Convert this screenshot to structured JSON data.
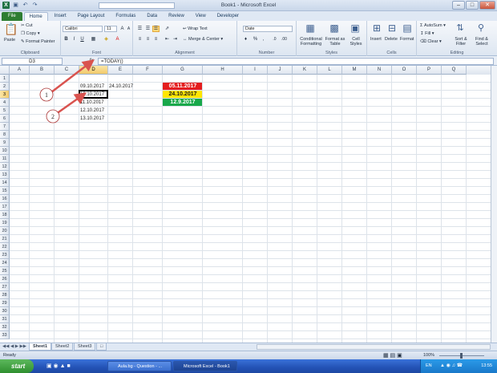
{
  "window": {
    "title": "Book1 - Microsoft Excel"
  },
  "qat": [
    "save-icon",
    "undo-icon",
    "redo-icon"
  ],
  "tabs": [
    "File",
    "Home",
    "Insert",
    "Page Layout",
    "Formulas",
    "Data",
    "Review",
    "View",
    "Developer"
  ],
  "ribbon": {
    "clipboard": {
      "label": "Clipboard",
      "paste": "Paste",
      "cut": "Cut",
      "copy": "Copy",
      "format_painter": "Format Painter"
    },
    "font": {
      "label": "Font",
      "name": "Calibri",
      "size": "11"
    },
    "alignment": {
      "label": "Alignment",
      "wrap": "Wrap Text",
      "merge": "Merge & Center"
    },
    "number": {
      "label": "Number",
      "format": "Date"
    },
    "styles": {
      "label": "Styles",
      "cond": "Conditional Formatting",
      "table": "Format as Table",
      "cell": "Cell Styles"
    },
    "cells": {
      "label": "Cells",
      "insert": "Insert",
      "delete": "Delete",
      "format": "Format"
    },
    "editing": {
      "label": "Editing",
      "autosum": "AutoSum",
      "fill": "Fill",
      "clear": "Clear",
      "sort": "Sort & Filter",
      "find": "Find & Select"
    }
  },
  "formula_bar": {
    "cell_ref": "D3",
    "fx": "fx",
    "formula": "=TODAY()"
  },
  "columns": [
    "A",
    "B",
    "C",
    "D",
    "E",
    "F",
    "G",
    "H",
    "I",
    "J",
    "K",
    "L",
    "M",
    "N",
    "O",
    "P",
    "Q"
  ],
  "rows": [
    "1",
    "2",
    "3",
    "4",
    "5",
    "6",
    "7",
    "8",
    "9",
    "10",
    "11",
    "12",
    "13",
    "14",
    "15",
    "16",
    "17",
    "18",
    "19",
    "20",
    "21",
    "22",
    "23",
    "24",
    "25",
    "26",
    "27",
    "28",
    "29",
    "30",
    "31",
    "32",
    "33"
  ],
  "cells": {
    "D2": "09.10.2017",
    "E2": "24.10.2017",
    "D3": "10.10.2017",
    "D4": "11.10.2017",
    "D5": "12.10.2017",
    "D6": "13.10.2017",
    "G2": "05.11.2017",
    "G3": "24.10.2017",
    "G4": "12.9.2017"
  },
  "cell_colors": {
    "G2": "#e41e1e",
    "G3": "#ffe600",
    "G4": "#18a84a"
  },
  "callouts": [
    "1",
    "2"
  ],
  "sheets": [
    "Sheet1",
    "Sheet2",
    "Sheet3"
  ],
  "status": {
    "ready": "Ready",
    "zoom": "100%"
  },
  "taskbar": {
    "start": "start",
    "tasks": [
      "Aula.bg - Question - ...",
      "Microsoft Excel - Book1"
    ],
    "lang": "EN",
    "clock": "13:55"
  }
}
